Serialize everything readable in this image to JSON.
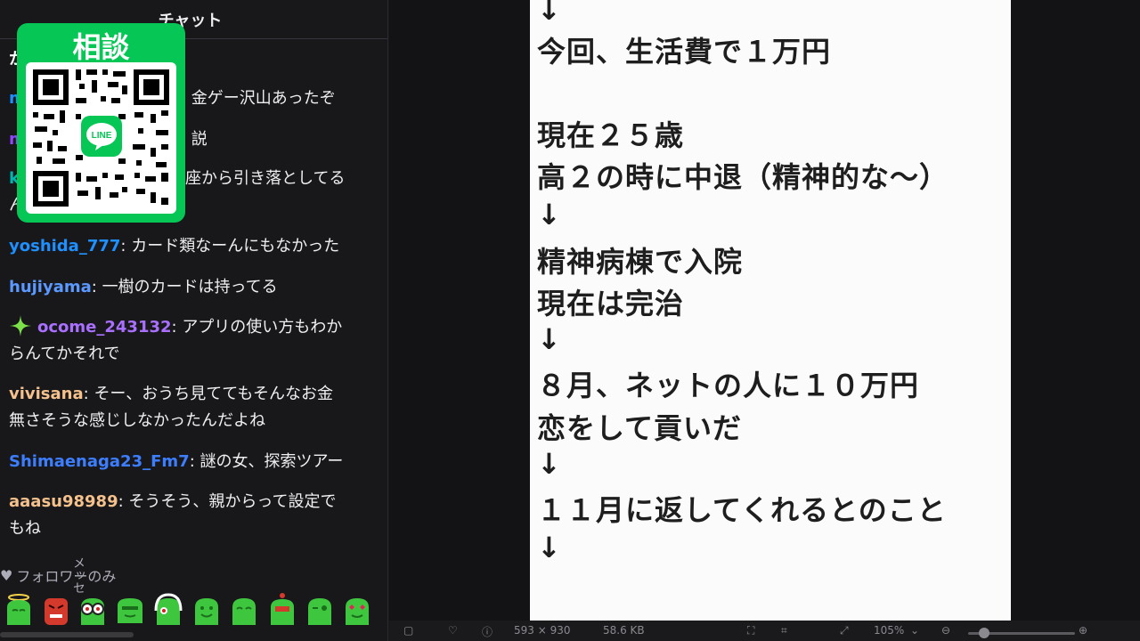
{
  "chat": {
    "title": "チャット",
    "qr": {
      "title": "相談",
      "badge": "LINE"
    },
    "messages": [
      {
        "user": "か",
        "text": "",
        "color": "#ffffff"
      },
      {
        "user": "m",
        "text": "金ゲー沢山あったぞ",
        "color": "#1e90ff"
      },
      {
        "user": "m",
        "text": "説",
        "color": "#9146ff"
      },
      {
        "user": "k",
        "text": "座から引き落としてる",
        "color": "#00b5ad"
      },
      {
        "user": "ん",
        "text": "",
        "color": "#ffffff"
      },
      {
        "user": "yoshida_777",
        "text": "カード類なーんにもなかった",
        "color": "#1e90ff"
      },
      {
        "user": "hujiyama",
        "text": "一樹のカードは持ってる",
        "color": "#5b99ff"
      },
      {
        "user": "ocome_243132",
        "text": "アプリの使い方もわか",
        "text2": "らんてかそれで",
        "color": "#a970ff",
        "badge": "sparkle"
      },
      {
        "user": "vivisana",
        "text": "そー、おうち見ててもそんなお金",
        "text2": "無さそうな感じしなかったんだよね",
        "color": "#f5c18c"
      },
      {
        "user": "Shimaenaga23_Fm7",
        "text": "謎の女、探索ツアー",
        "color": "#3d7eff"
      },
      {
        "user": "aaasu98989",
        "text": "そうそう、親からって設定で",
        "text2": "もね",
        "color": "#f5c18c"
      }
    ],
    "follower_only": "フォロワーのみ",
    "cursor_text": "メッセ",
    "emotes": [
      "halo-emote",
      "angry-emote",
      "glasses-emote",
      "smirk-emote",
      "headphones-emote",
      "smile-emote",
      "happy-emote",
      "robot-emote",
      "wink-emote",
      "heart-eyes-emote"
    ]
  },
  "document": {
    "lines": [
      "↓",
      "今回、生活費で１万円",
      "",
      "現在２５歳",
      "高２の時に中退（精神的な～）",
      "↓",
      "精神病棟で入院",
      "現在は完治",
      "↓",
      "８月、ネットの人に１０万円",
      "恋をして貢いだ",
      "↓",
      "１１月に返してくれるとのこと",
      "↓"
    ]
  },
  "toolbar": {
    "dimensions": "593 × 930",
    "filesize": "58.6 KB",
    "zoom": "105%"
  },
  "colors": {
    "line_green": "#06c755",
    "panel_bg": "#18181b",
    "doc_bg": "#fbfbfb"
  }
}
